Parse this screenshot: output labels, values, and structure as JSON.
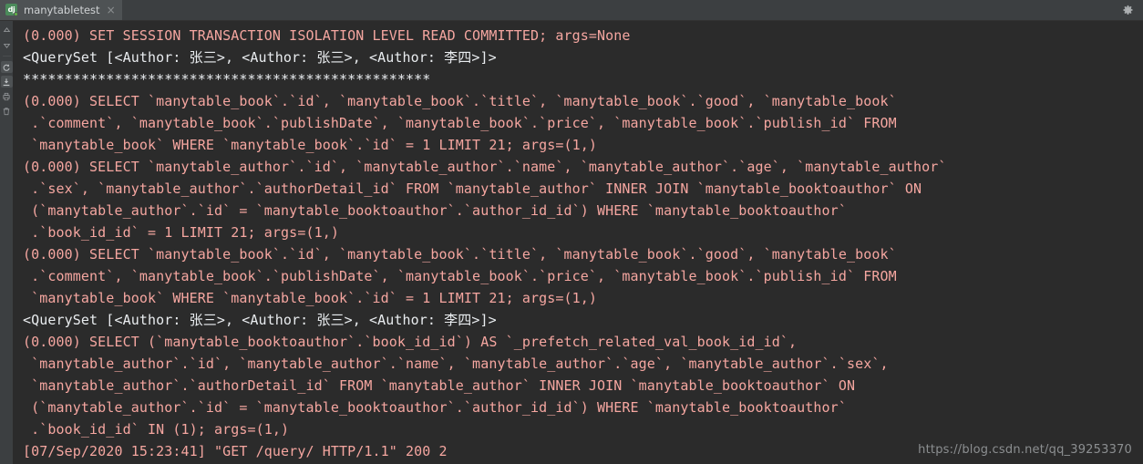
{
  "window": {
    "title": "manytabletest"
  },
  "tab_bar": {
    "tab": {
      "icon": "django-run-icon",
      "icon_text": "dj",
      "label": "manytabletest",
      "close_glyph": "×"
    },
    "settings_icon": "gear-icon"
  },
  "side_toolbar": {
    "buttons": [
      {
        "name": "up-arrow-icon",
        "title": "Up the stack trace"
      },
      {
        "name": "down-arrow-icon",
        "title": "Down the stack trace"
      },
      {
        "name": "rerun-icon",
        "title": "Rerun"
      },
      {
        "name": "scroll-to-end-icon",
        "title": "Scroll to the end"
      },
      {
        "name": "print-icon",
        "title": "Print"
      },
      {
        "name": "trash-icon",
        "title": "Clear all"
      }
    ]
  },
  "console": {
    "colors": {
      "background": "#2b2b2b",
      "sql_text": "#f5a6a0",
      "output_text": "#e9ecef",
      "tab_bar": "#3c3f41",
      "tab_active": "#4e5254",
      "watermark": "#8c8f91",
      "run_dot": "#62b543"
    },
    "lines": [
      {
        "kind": "sql",
        "text": "(0.000) SET SESSION TRANSACTION ISOLATION LEVEL READ COMMITTED; args=None"
      },
      {
        "kind": "output",
        "text": "<QuerySet [<Author: 张三>, <Author: 张三>, <Author: 李四>]>"
      },
      {
        "kind": "sep",
        "text": "*************************************************"
      },
      {
        "kind": "sql",
        "text": "(0.000) SELECT `manytable_book`.`id`, `manytable_book`.`title`, `manytable_book`.`good`, `manytable_book`"
      },
      {
        "kind": "sql",
        "text": " .`comment`, `manytable_book`.`publishDate`, `manytable_book`.`price`, `manytable_book`.`publish_id` FROM"
      },
      {
        "kind": "sql",
        "text": " `manytable_book` WHERE `manytable_book`.`id` = 1 LIMIT 21; args=(1,)"
      },
      {
        "kind": "sql",
        "text": "(0.000) SELECT `manytable_author`.`id`, `manytable_author`.`name`, `manytable_author`.`age`, `manytable_author`"
      },
      {
        "kind": "sql",
        "text": " .`sex`, `manytable_author`.`authorDetail_id` FROM `manytable_author` INNER JOIN `manytable_booktoauthor` ON"
      },
      {
        "kind": "sql",
        "text": " (`manytable_author`.`id` = `manytable_booktoauthor`.`author_id_id`) WHERE `manytable_booktoauthor`"
      },
      {
        "kind": "sql",
        "text": " .`book_id_id` = 1 LIMIT 21; args=(1,)"
      },
      {
        "kind": "sql",
        "text": "(0.000) SELECT `manytable_book`.`id`, `manytable_book`.`title`, `manytable_book`.`good`, `manytable_book`"
      },
      {
        "kind": "sql",
        "text": " .`comment`, `manytable_book`.`publishDate`, `manytable_book`.`price`, `manytable_book`.`publish_id` FROM"
      },
      {
        "kind": "sql",
        "text": " `manytable_book` WHERE `manytable_book`.`id` = 1 LIMIT 21; args=(1,)"
      },
      {
        "kind": "output",
        "text": "<QuerySet [<Author: 张三>, <Author: 张三>, <Author: 李四>]>"
      },
      {
        "kind": "sql",
        "text": "(0.000) SELECT (`manytable_booktoauthor`.`book_id_id`) AS `_prefetch_related_val_book_id_id`,"
      },
      {
        "kind": "sql",
        "text": " `manytable_author`.`id`, `manytable_author`.`name`, `manytable_author`.`age`, `manytable_author`.`sex`,"
      },
      {
        "kind": "sql",
        "text": " `manytable_author`.`authorDetail_id` FROM `manytable_author` INNER JOIN `manytable_booktoauthor` ON"
      },
      {
        "kind": "sql",
        "text": " (`manytable_author`.`id` = `manytable_booktoauthor`.`author_id_id`) WHERE `manytable_booktoauthor`"
      },
      {
        "kind": "sql",
        "text": " .`book_id_id` IN (1); args=(1,)"
      },
      {
        "kind": "sql",
        "text": "[07/Sep/2020 15:23:41] \"GET /query/ HTTP/1.1\" 200 2"
      }
    ]
  },
  "watermark": {
    "text": "https://blog.csdn.net/qq_39253370"
  }
}
